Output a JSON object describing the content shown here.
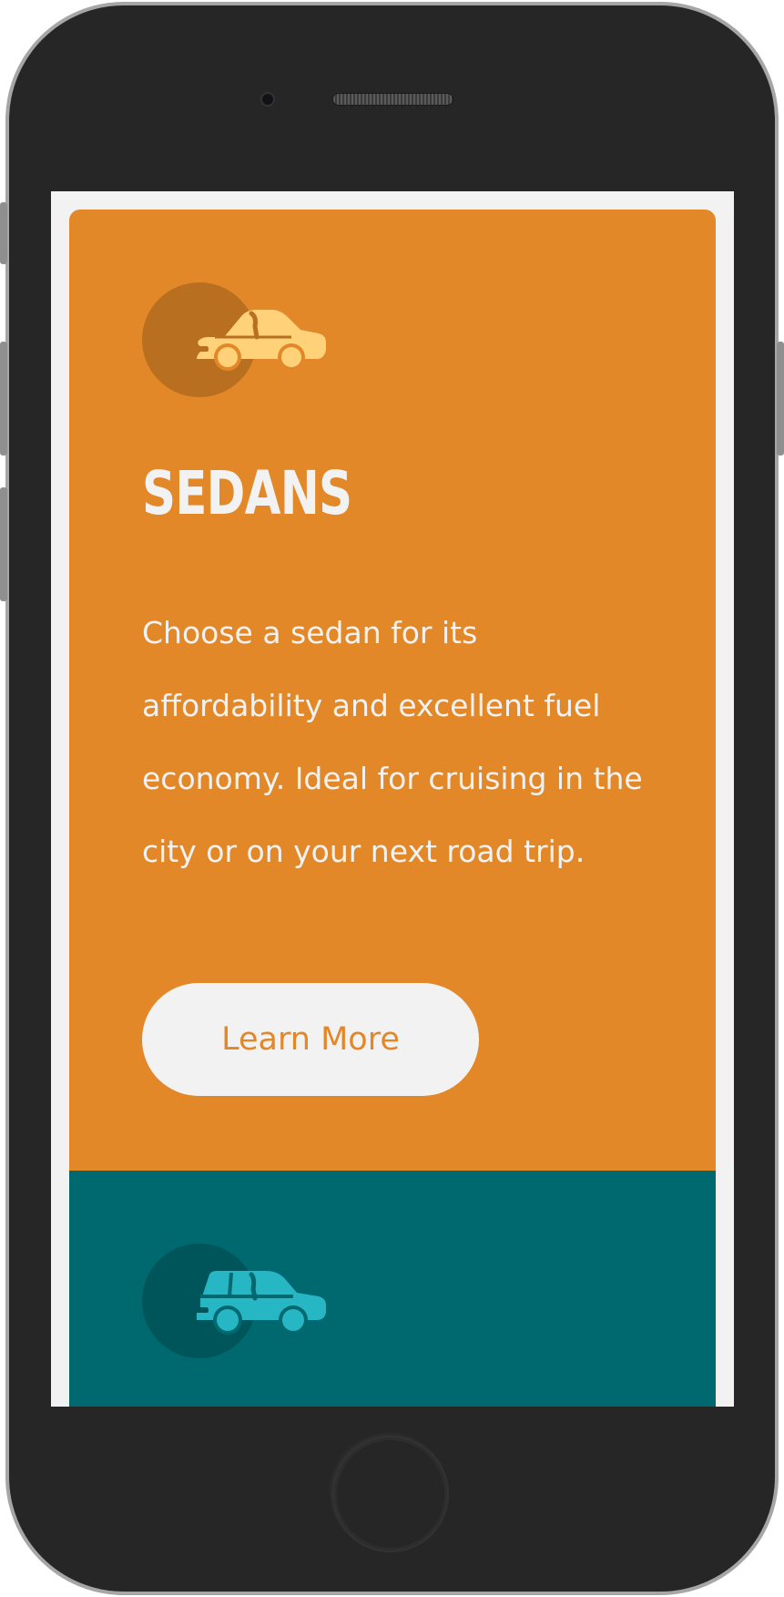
{
  "sedan_card": {
    "icon": "sedan-car-icon",
    "title": "SEDANS",
    "description": "Choose a sedan for its affordability and excellent fuel economy. Ideal for cruising in the city or on your next road trip.",
    "button_label": "Learn More",
    "background_color": "#e28828",
    "icon_circle_color": "#b86f1f",
    "icon_color": "#ffd27a",
    "text_color": "#f2f2f2"
  },
  "suv_card": {
    "icon": "suv-car-icon",
    "background_color": "#006970",
    "icon_circle_color": "#00555a",
    "icon_color": "#27b6c4"
  }
}
